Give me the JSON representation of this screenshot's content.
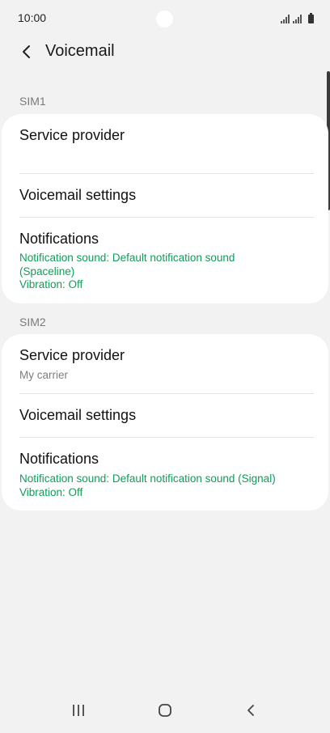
{
  "status_bar": {
    "time": "10:00"
  },
  "header": {
    "title": "Voicemail"
  },
  "sim1": {
    "label": "SIM1",
    "service_provider": {
      "title": "Service provider",
      "subtitle": ""
    },
    "voicemail_settings": {
      "title": "Voicemail settings"
    },
    "notifications": {
      "title": "Notifications",
      "sound_line1": "Notification sound: Default notification sound",
      "sound_line2": "(Spaceline)",
      "vibration": "Vibration: Off"
    }
  },
  "sim2": {
    "label": "SIM2",
    "service_provider": {
      "title": "Service provider",
      "subtitle": "My carrier"
    },
    "voicemail_settings": {
      "title": "Voicemail settings"
    },
    "notifications": {
      "title": "Notifications",
      "sound": "Notification sound: Default notification sound (Signal)",
      "vibration": "Vibration: Off"
    }
  },
  "colors": {
    "accent_green": "#109d59",
    "background": "#f2f2f2",
    "card": "#ffffff"
  },
  "icons": {
    "back": "chevron-left-icon",
    "nav_recents": "recents-icon",
    "nav_home": "home-icon",
    "nav_back": "back-icon"
  }
}
